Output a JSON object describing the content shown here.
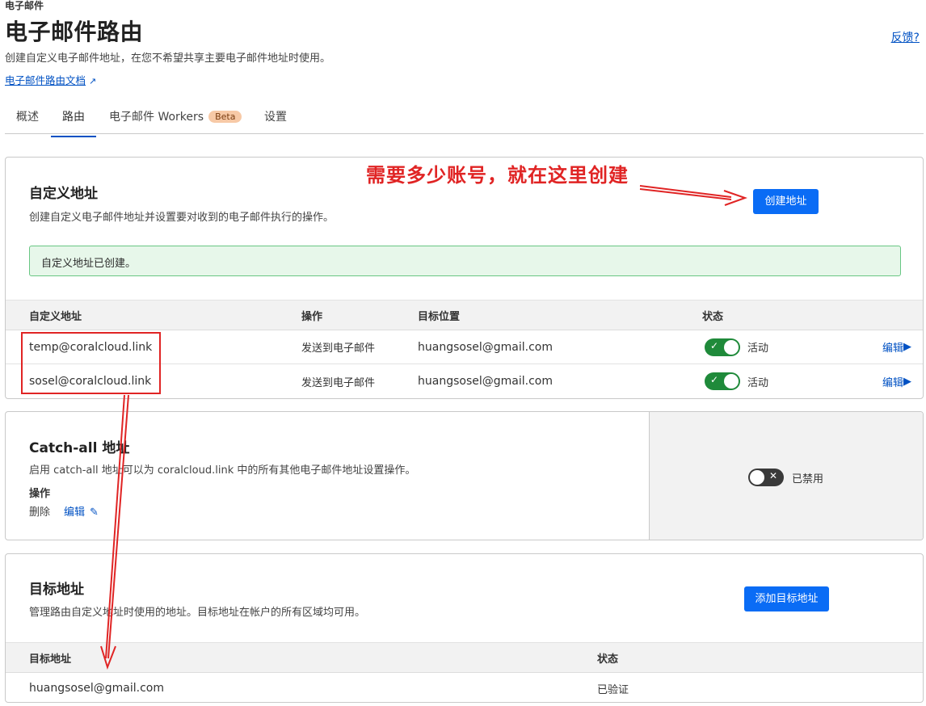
{
  "header": {
    "breadcrumb": "电子邮件",
    "title": "电子邮件路由",
    "subtitle": "创建自定义电子邮件地址，在您不希望共享主要电子邮件地址时使用。",
    "doc_link": "电子邮件路由文档",
    "feedback": "反馈?"
  },
  "tabs": [
    {
      "label": "概述"
    },
    {
      "label": "路由"
    },
    {
      "label": "电子邮件 Workers",
      "badge": "Beta"
    },
    {
      "label": "设置"
    }
  ],
  "annotation": {
    "text": "需要多少账号，就在这里创建",
    "color": "#e02424"
  },
  "custom_addresses": {
    "title": "自定义地址",
    "description": "创建自定义电子邮件地址并设置要对收到的电子邮件执行的操作。",
    "create_button": "创建地址",
    "success_message": "自定义地址已创建。",
    "columns": [
      "自定义地址",
      "操作",
      "目标位置",
      "状态"
    ],
    "rows": [
      {
        "address": "temp@coralcloud.link",
        "action": "发送到电子邮件",
        "destination": "huangsosel@gmail.com",
        "status": "活动",
        "edit": "编辑"
      },
      {
        "address": "sosel@coralcloud.link",
        "action": "发送到电子邮件",
        "destination": "huangsosel@gmail.com",
        "status": "活动",
        "edit": "编辑"
      }
    ]
  },
  "catch_all": {
    "title": "Catch-all 地址",
    "description": "启用 catch-all 地址可以为 coralcloud.link 中的所有其他电子邮件地址设置操作。",
    "action_label": "操作",
    "action_value": "删除",
    "edit": "编辑",
    "status": "已禁用"
  },
  "destination_addresses": {
    "title": "目标地址",
    "description": "管理路由自定义地址时使用的地址。目标地址在帐户的所有区域均可用。",
    "add_button": "添加目标地址",
    "columns": [
      "目标地址",
      "状态"
    ],
    "rows": [
      {
        "address": "huangsosel@gmail.com",
        "status": "已验证"
      }
    ]
  },
  "colors": {
    "accent": "#0a6cf5",
    "link": "#0051c3",
    "toggle_on": "#1f8a3a",
    "success_bg": "#e7f7ea"
  }
}
